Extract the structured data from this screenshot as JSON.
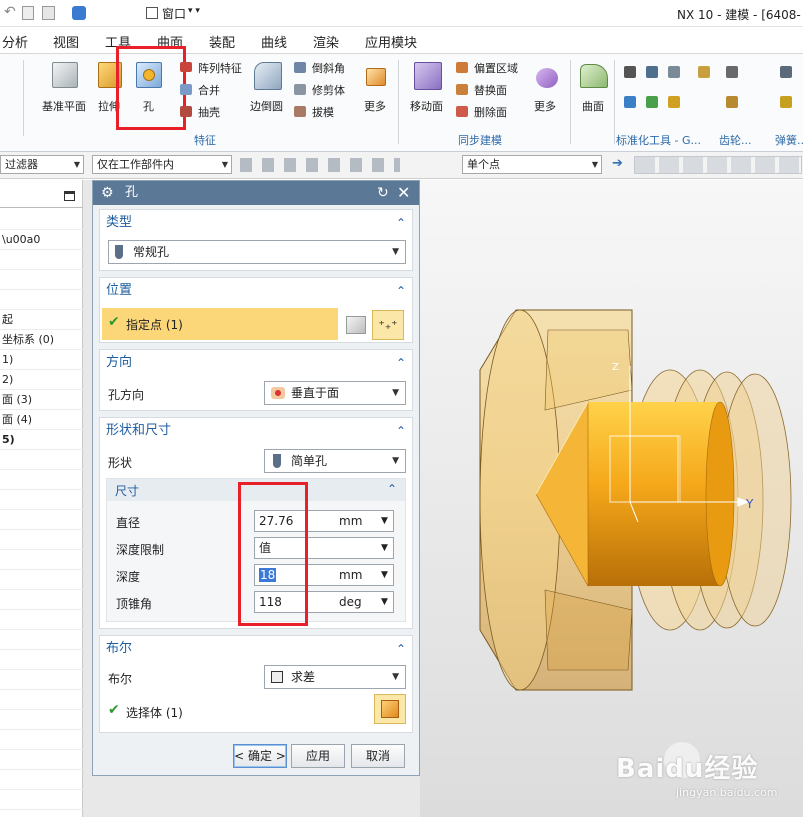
{
  "titlebar": {
    "app_title": "NX 10 - 建模 - [6408-",
    "window_menu": "窗口"
  },
  "menubar": {
    "items": [
      "分析",
      "视图",
      "工具",
      "曲面",
      "装配",
      "曲线",
      "渲染",
      "应用模块"
    ]
  },
  "ribbon": {
    "datum_plane": "基准平面",
    "extrude": "拉伸",
    "hole": "孔",
    "pattern_feature": "阵列特征",
    "combine": "合并",
    "shell": "抽壳",
    "edge_blend": "边倒圆",
    "chamfer": "倒斜角",
    "trim_body": "修剪体",
    "draft": "拔模",
    "more1": "更多",
    "move_face": "移动面",
    "offset_region": "偏置区域",
    "replace_face": "替换面",
    "delete_face": "删除面",
    "more2": "更多",
    "surface": "曲面",
    "group_feature": "特征",
    "group_sync": "同步建模",
    "group_std": "标准化工具 - G...",
    "group_gear": "齿轮...",
    "group_spring": "弹簧..."
  },
  "filterbar": {
    "filter": "过滤器",
    "scope": "仅在工作部件内",
    "snap": "单个点"
  },
  "nav": {
    "rows": [
      "",
      "",
      "",
      "",
      "",
      "",
      "",
      "起",
      "坐标系 (0)",
      "1)",
      "2)",
      "面 (3)",
      "面 (4)",
      "5)"
    ]
  },
  "dialog": {
    "title": "孔",
    "type": {
      "header": "类型",
      "value": "常规孔"
    },
    "position": {
      "header": "位置",
      "point": "指定点 (1)"
    },
    "direction": {
      "header": "方向",
      "label": "孔方向",
      "value": "垂直于面"
    },
    "shape": {
      "header": "形状和尺寸",
      "shape_label": "形状",
      "shape_value": "简单孔",
      "dims_header": "尺寸",
      "diameter_label": "直径",
      "diameter_value": "27.76",
      "diameter_unit": "mm",
      "depth_limit_label": "深度限制",
      "depth_limit_value": "值",
      "depth_label": "深度",
      "depth_value": "18",
      "depth_unit": "mm",
      "tip_angle_label": "顶锥角",
      "tip_angle_value": "118",
      "tip_angle_unit": "deg"
    },
    "boolean": {
      "header": "布尔",
      "label": "布尔",
      "value": "求差",
      "select_body": "选择体 (1)"
    },
    "buttons": {
      "ok": "< 确定 >",
      "apply": "应用",
      "cancel": "取消"
    }
  },
  "viewport": {
    "axis_y": "Y",
    "axis_z": "Z"
  },
  "watermark": {
    "brand": "Baidu经验",
    "url": "jingyan.baidu.com"
  }
}
